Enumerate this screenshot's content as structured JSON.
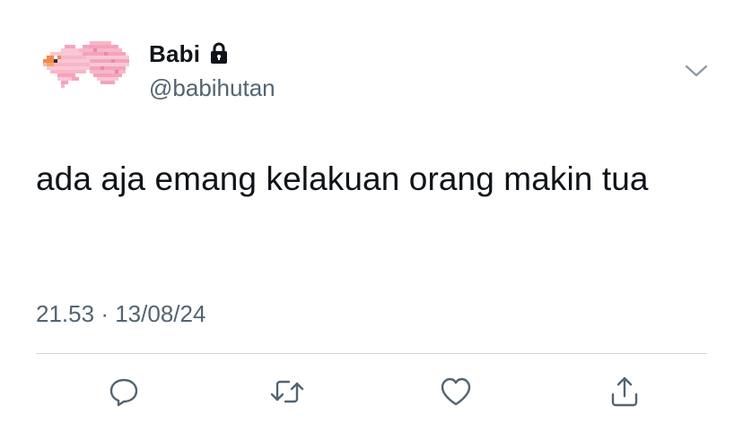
{
  "author": {
    "display_name": "Babi",
    "handle": "@babihutan",
    "avatar_icon": "pixel-betta-fish-icon",
    "protected_icon": "lock-icon"
  },
  "tweet": {
    "text": "ada aja emang kelakuan orang makin tua",
    "time": "21.53",
    "separator": "·",
    "date": "13/08/24"
  },
  "actions": {
    "reply_icon": "reply-icon",
    "retweet_icon": "retweet-icon",
    "like_icon": "heart-icon",
    "share_icon": "share-icon"
  },
  "colors": {
    "text": "#0f1419",
    "secondary": "#536471",
    "divider": "#cfd9de",
    "action_icon": "#536471"
  }
}
